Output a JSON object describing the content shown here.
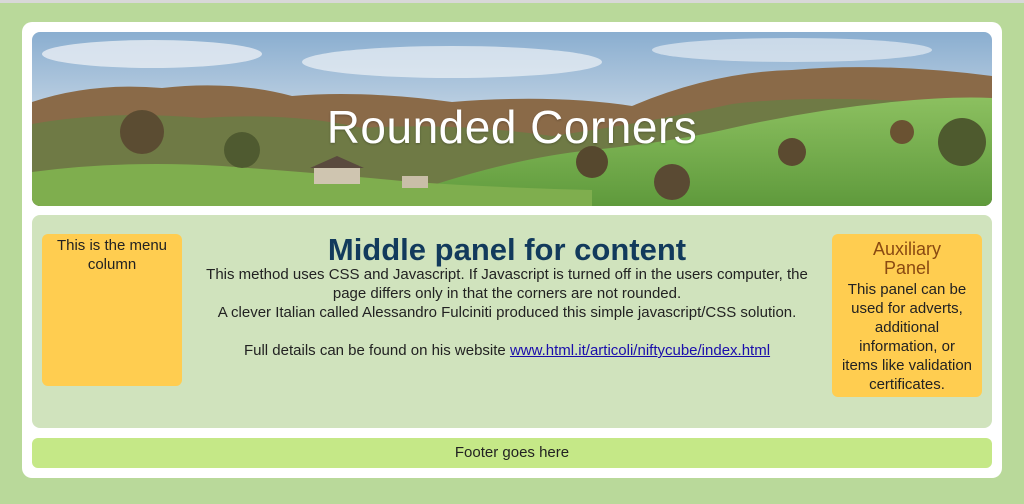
{
  "banner": {
    "title": "Rounded Corners"
  },
  "menu": {
    "text": "This is the menu column"
  },
  "main": {
    "title": "Middle panel for content",
    "paragraph1": "This method uses CSS and Javascript. If Javascript is turned off in the users computer, the page differs only in that the corners are not rounded.",
    "paragraph2": "A clever Italian called Alessandro Fulciniti produced this simple javascript/CSS solution.",
    "details_prefix": "Full details can be found on his website ",
    "link_text": "www.html.it/articoli/niftycube/index.html"
  },
  "aux": {
    "title": "Auxiliary Panel",
    "text": "This panel can be used for adverts, additional information, or items like validation certificates."
  },
  "footer": {
    "text": "Footer goes here"
  },
  "colors": {
    "page_background": "#b9d99a",
    "content_background": "#d0e3bd",
    "side_panel": "#ffcd50",
    "footer_background": "#c5e887",
    "link": "#1a0dab"
  }
}
